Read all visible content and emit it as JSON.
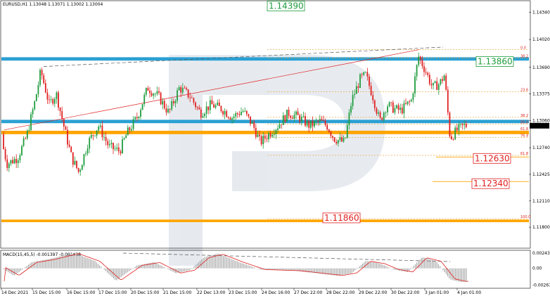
{
  "chart_data": [
    {
      "type": "candlestick",
      "header": "EURUSD,H1  1.13048 1.13071 1.13002 1.13004",
      "price_tag": "1.13004",
      "ylim": [
        1.1156,
        1.1447
      ],
      "y_ticks": [
        "1.14340",
        "1.14020",
        "1.13690",
        "1.13375",
        "1.13060",
        "1.12740",
        "1.12425",
        "1.12110",
        "1.11800"
      ],
      "x_ticks": [
        "14 Dec 2021",
        "15 Dec 15:00",
        "16 Dec 15:00",
        "17 Dec 15:00",
        "20 Dec 15:00",
        "21 Dec 15:00",
        "22 Dec 13:00",
        "23 Dec 15:00",
        "24 Dec 16:00",
        "27 Dec 22:00",
        "28 Dec 22:00",
        "29 Dec 22:00",
        "30 Dec 22:00",
        "3 Jan 01:00",
        "4 Jan 01:00"
      ],
      "levels": [
        {
          "label": "1.14390",
          "value": 1.1439,
          "color": "#1e9c3c",
          "style": "solid"
        },
        {
          "label": "1.13860",
          "value": 1.138,
          "color": "#1e9c3c",
          "style": "solid"
        },
        {
          "label": "1.12630",
          "value": 1.1263,
          "color": "#e02020",
          "style": "dotted"
        },
        {
          "label": "1.12340",
          "value": 1.1234,
          "color": "#e02020",
          "style": "dotted"
        },
        {
          "label": "1.11860",
          "value": 1.1186,
          "color": "#e02020",
          "style": "dotted"
        }
      ],
      "fibo_levels": [
        {
          "label": "0.0",
          "value": 1.139
        },
        {
          "label": "38.2",
          "value": 1.138
        },
        {
          "label": "23.6",
          "value": 1.134
        },
        {
          "label": "38.2",
          "value": 1.131
        },
        {
          "label": "50.0",
          "value": 1.1302
        },
        {
          "label": "61.8",
          "value": 1.1294
        },
        {
          "label": "76.4",
          "value": 1.1286
        },
        {
          "label": "61.8",
          "value": 1.1265
        },
        {
          "label": "100.0",
          "value": 1.119
        }
      ],
      "colors": {
        "bull": "#1e9c3c",
        "bear": "#e02020",
        "support": "#ffa500",
        "resistance": "#2aa0d4"
      }
    },
    {
      "type": "histogram",
      "title": "MACD(15,45,5) -0.001397 -0.001438",
      "ylim": [
        -0.0031,
        0.0028
      ],
      "y_ticks": [
        "0.002437",
        "0.00",
        "-0.002675"
      ]
    }
  ]
}
